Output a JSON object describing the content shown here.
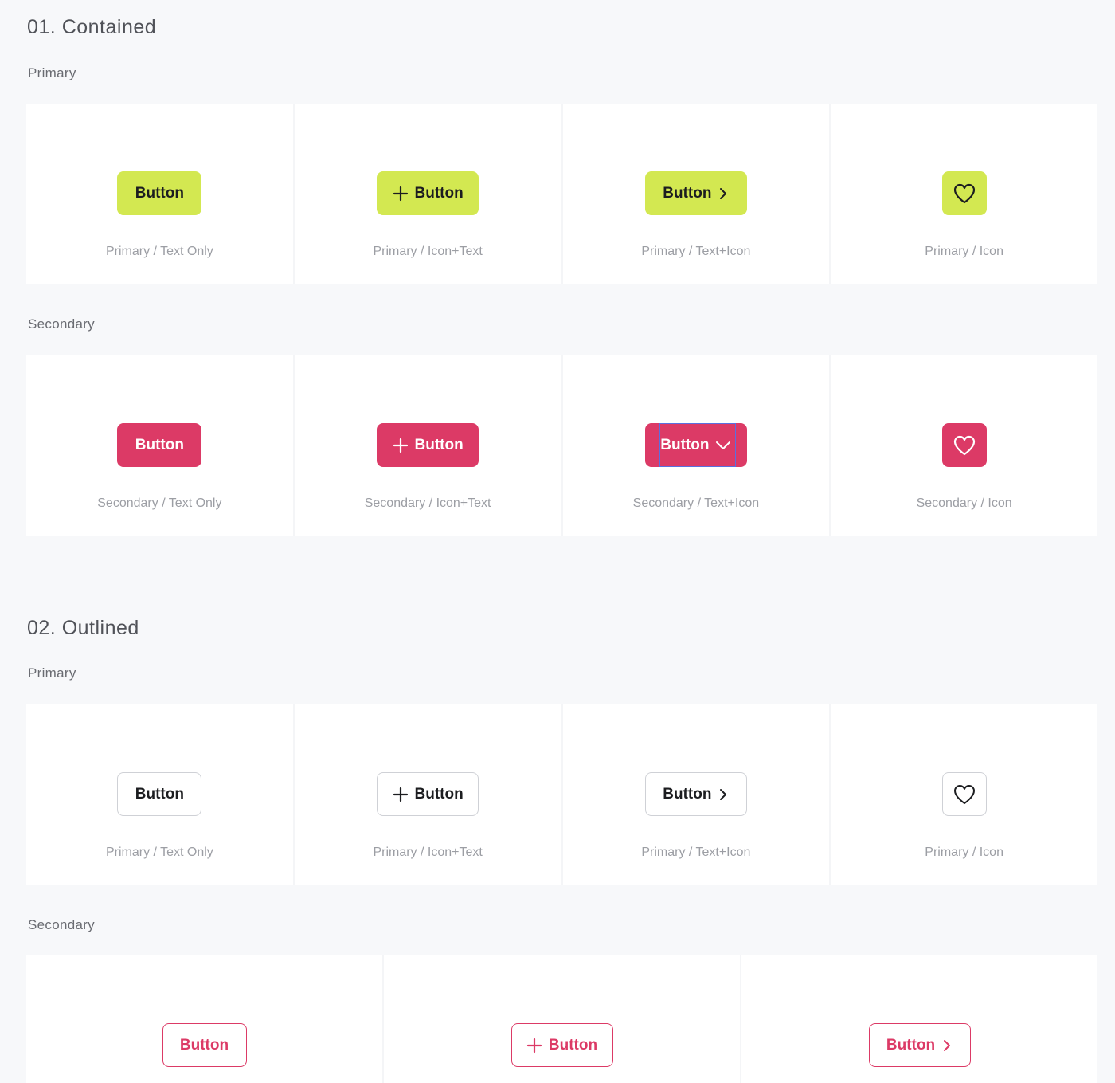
{
  "sections": [
    {
      "title": "01. Contained",
      "groups": [
        {
          "label": "Primary",
          "items": [
            {
              "button_label": "Button",
              "caption": "Primary / Text Only"
            },
            {
              "button_label": "Button",
              "caption": "Primary / Icon+Text",
              "icon": "plus-icon"
            },
            {
              "button_label": "Button",
              "caption": "Primary / Text+Icon",
              "icon": "chevron-right-icon"
            },
            {
              "caption": "Primary / Icon",
              "icon": "heart-icon"
            }
          ]
        },
        {
          "label": "Secondary",
          "items": [
            {
              "button_label": "Button",
              "caption": "Secondary / Text Only"
            },
            {
              "button_label": "Button",
              "caption": "Secondary / Icon+Text",
              "icon": "plus-icon"
            },
            {
              "button_label": "Button",
              "caption": "Secondary / Text+Icon",
              "icon": "chevron-down-icon"
            },
            {
              "caption": "Secondary / Icon",
              "icon": "heart-icon"
            }
          ]
        }
      ]
    },
    {
      "title": "02. Outlined",
      "groups": [
        {
          "label": "Primary",
          "items": [
            {
              "button_label": "Button",
              "caption": "Primary / Text Only"
            },
            {
              "button_label": "Button",
              "caption": "Primary / Icon+Text",
              "icon": "plus-icon"
            },
            {
              "button_label": "Button",
              "caption": "Primary / Text+Icon",
              "icon": "chevron-right-icon"
            },
            {
              "caption": "Primary / Icon",
              "icon": "heart-icon"
            }
          ]
        },
        {
          "label": "Secondary",
          "items": [
            {
              "button_label": "Button"
            },
            {
              "button_label": "Button",
              "icon": "plus-icon"
            },
            {
              "button_label": "Button",
              "icon": "chevron-right-icon"
            }
          ]
        }
      ]
    }
  ],
  "colors": {
    "page_background": "#f7f8fa",
    "primary_accent": "#d3e851",
    "secondary_accent": "#dc3a66",
    "caption_text": "#9c9ea4",
    "focus_outline": "#5a6fe0"
  }
}
